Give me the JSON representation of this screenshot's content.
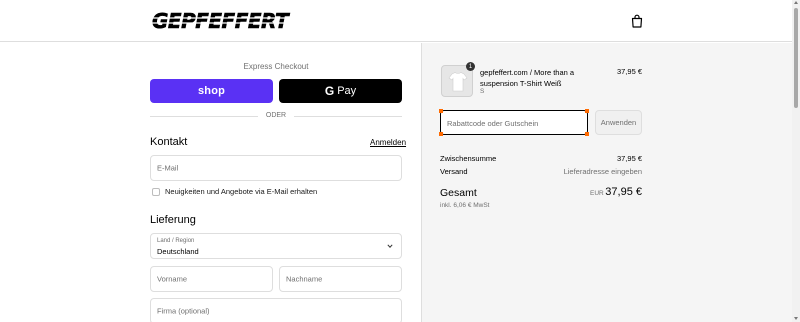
{
  "header": {
    "logo_text": "GEPFEFFERT",
    "cart_icon": "shopping-bag-icon"
  },
  "express": {
    "label": "Express Checkout",
    "shop_label": "shop",
    "gpay_g": "G",
    "gpay_label": "Pay",
    "or_label": "ODER",
    "shop_color": "#5a31f4"
  },
  "contact": {
    "title": "Kontakt",
    "login_link": "Anmelden",
    "email_placeholder": "E-Mail",
    "newsletter_label": "Neuigkeiten und Angebote via E-Mail erhalten"
  },
  "delivery": {
    "title": "Lieferung",
    "country_label": "Land / Region",
    "country_value": "Deutschland",
    "first_name_placeholder": "Vorname",
    "last_name_placeholder": "Nachname",
    "company_placeholder": "Firma (optional)"
  },
  "summary": {
    "product_name": "gepfeffert.com / More than a suspension T-Shirt Weiß",
    "product_variant": "S",
    "product_qty": "1",
    "product_price": "37,95 €",
    "discount_placeholder": "Rabattcode oder Gutschein",
    "apply_label": "Anwenden",
    "subtotal_label": "Zwischensumme",
    "subtotal_value": "37,95 €",
    "shipping_label": "Versand",
    "shipping_value": "Lieferadresse eingeben",
    "total_label": "Gesamt",
    "total_currency": "EUR",
    "total_value": "37,95 €",
    "tax_note": "inkl. 6,06 € MwSt"
  }
}
